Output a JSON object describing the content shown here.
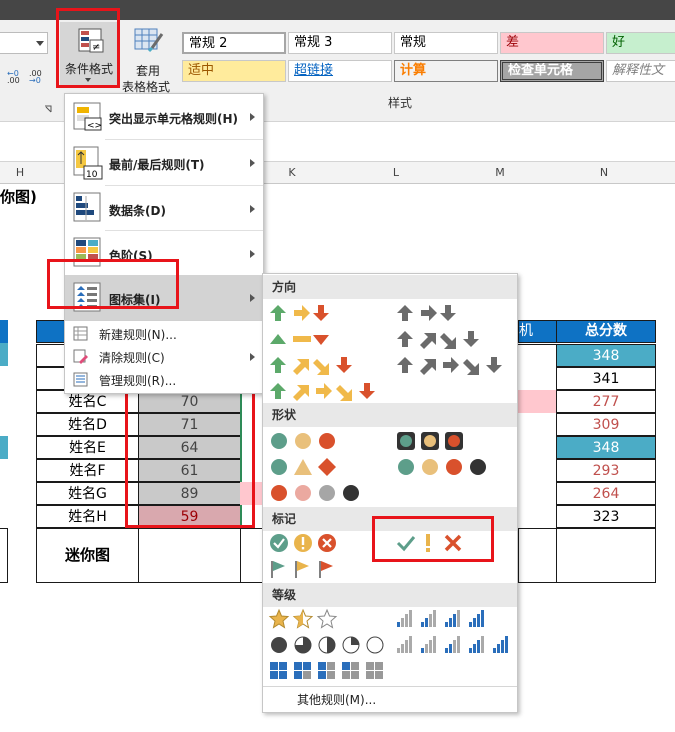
{
  "ribbon": {
    "conditional_format_label": "条件格式",
    "table_format_label_1": "套用",
    "table_format_label_2": "表格格式",
    "styles_group_label": "样式",
    "cell_styles": [
      {
        "label": "常规 2",
        "bg": "#ffffff"
      },
      {
        "label": "常规 3",
        "bg": "#ffffff"
      },
      {
        "label": "常规",
        "bg": "#ffffff"
      },
      {
        "label": "差",
        "bg": "#ffc7ce",
        "color": "#9c0006"
      },
      {
        "label": "好",
        "bg": "#c6efce",
        "color": "#006100"
      },
      {
        "label": "适中",
        "bg": "#ffeb9c",
        "color": "#9c5700"
      },
      {
        "label": "超链接",
        "bg": "#ffffff",
        "color": "#0563c1"
      },
      {
        "label": "计算",
        "bg": "#f2f2f2",
        "color": "#fa7d00"
      },
      {
        "label": "检查单元格",
        "bg": "#a5a5a5",
        "color": "#ffffff"
      },
      {
        "label": "解释性文",
        "bg": "#ffffff",
        "color": "#7f7f7f"
      }
    ]
  },
  "columns": [
    "H",
    "K",
    "L",
    "M",
    "N"
  ],
  "sheet": {
    "title_fragment": "你图)",
    "left_header_fragment": "​",
    "total_header": "总分数",
    "machine_header_fragment": "机",
    "names": [
      "姓名C",
      "姓名D",
      "姓名E",
      "姓名F",
      "姓名G",
      "姓名H"
    ],
    "scores": [
      "70",
      "71",
      "64",
      "61",
      "89",
      "59"
    ],
    "totals": [
      "348",
      "341",
      "277",
      "309",
      "348",
      "293",
      "264",
      "323"
    ],
    "sparkline_label": "迷你图"
  },
  "menu": {
    "items": [
      {
        "label": "突出显示单元格规则(H)"
      },
      {
        "label": "最前/最后规则(T)"
      },
      {
        "label": "数据条(D)"
      },
      {
        "label": "色阶(S)"
      },
      {
        "label": "图标集(I)"
      }
    ],
    "actions": [
      "新建规则(N)...",
      "清除规则(C)",
      "管理规则(R)..."
    ]
  },
  "submenu": {
    "sections": [
      "方向",
      "形状",
      "标记",
      "等级"
    ],
    "more_rules": "其他规则(M)..."
  },
  "colors": {
    "accent_red": "#e8141a",
    "header_blue": "#0e72c4",
    "teal": "#4bacc6",
    "red_text": "#c0504d"
  }
}
